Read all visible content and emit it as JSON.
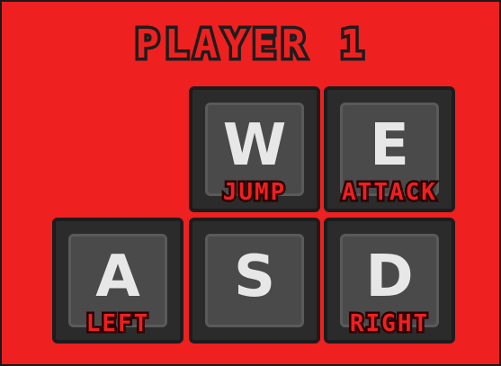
{
  "title": "PLAYER 1",
  "keys": {
    "w": {
      "letter": "W",
      "action": "JUMP"
    },
    "e": {
      "letter": "E",
      "action": "ATTACK"
    },
    "a": {
      "letter": "A",
      "action": "LEFT"
    },
    "s": {
      "letter": "S",
      "action": ""
    },
    "d": {
      "letter": "D",
      "action": "RIGHT"
    }
  },
  "colors": {
    "background": "#ef2020",
    "key_body": "#2b2b2b",
    "key_face": "#4a4a4a",
    "key_letter": "#e7e7e7",
    "label": "#ef2020",
    "outline": "#1d1d1d"
  }
}
